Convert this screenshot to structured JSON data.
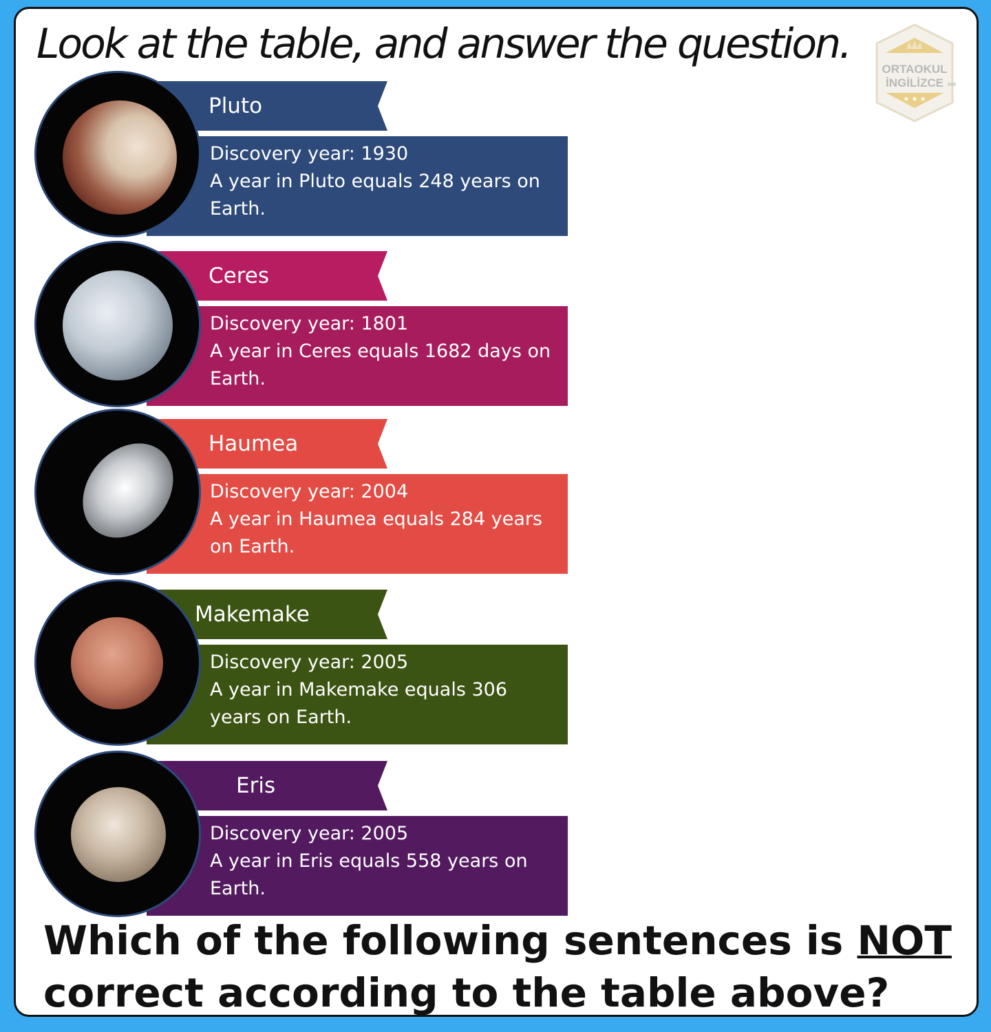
{
  "header": {
    "title": "Look at the table, and answer the question."
  },
  "logo": {
    "line1": "ORTAOKUL",
    "line2": "İNGİLİZCE",
    "suffix": "net"
  },
  "planets": [
    {
      "name": "Pluto",
      "discovery": "Discovery year: 1930",
      "year_fact": "A year in Pluto equals 248 years on Earth.",
      "color": "#2d4a7a"
    },
    {
      "name": "Ceres",
      "discovery": "Discovery year: 1801",
      "year_fact": "A year in Ceres equals 1682 days on Earth.",
      "color": "#b81c61"
    },
    {
      "name": "Haumea",
      "discovery": "Discovery year: 2004",
      "year_fact": "A year in Haumea equals 284 years on Earth.",
      "color": "#e24a43"
    },
    {
      "name": "Makemake",
      "discovery": "Discovery year: 2005",
      "year_fact": "A year in Makemake equals 306 years on Earth.",
      "color": "#3c5413"
    },
    {
      "name": "Eris",
      "discovery": "Discovery year: 2005",
      "year_fact": "A year in Eris equals 558 years on Earth.",
      "color": "#531a60"
    }
  ],
  "question": {
    "part1": "Which of the following sentences is ",
    "emphasis": "NOT",
    "part2": " correct according to the table above?"
  }
}
